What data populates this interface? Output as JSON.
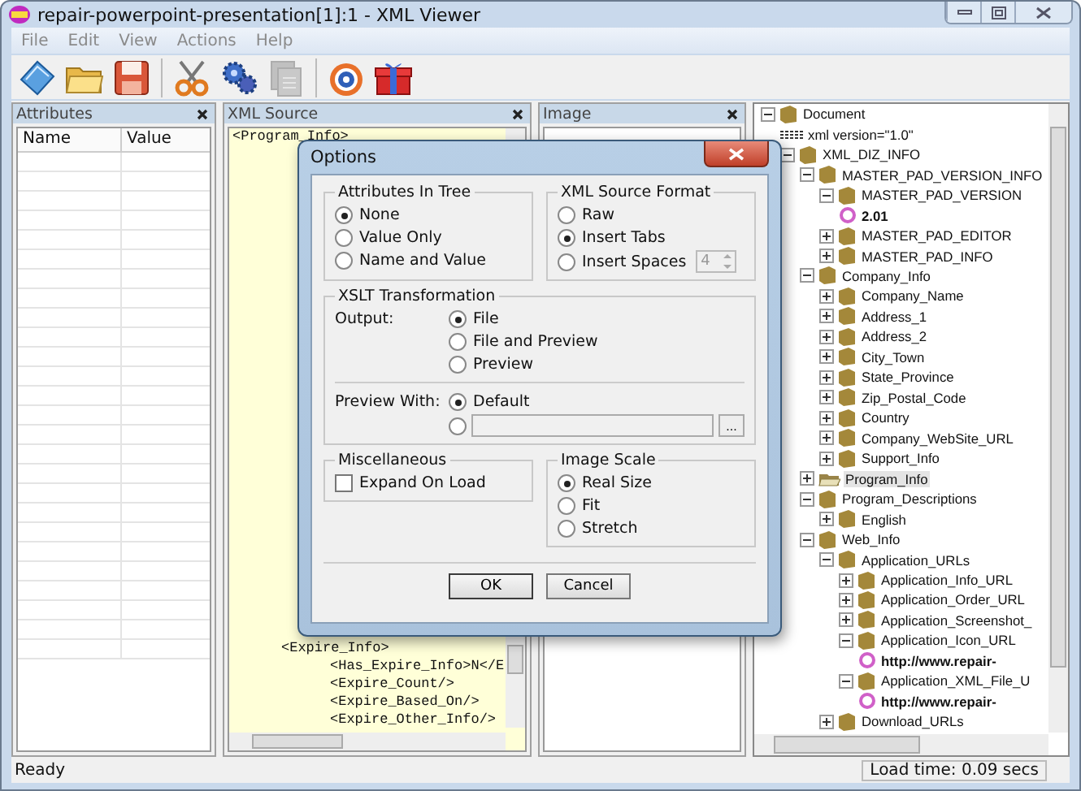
{
  "window": {
    "title": "repair-powerpoint-presentation[1]:1 - XML Viewer"
  },
  "menu": [
    "File",
    "Edit",
    "View",
    "Actions",
    "Help"
  ],
  "toolbar": [
    [
      {
        "kind": "notebook",
        "disabled": false
      },
      {
        "kind": "folder",
        "disabled": false
      },
      {
        "kind": "disk",
        "disabled": false
      }
    ],
    [
      {
        "kind": "scissors",
        "disabled": false
      },
      {
        "kind": "gears",
        "disabled": false
      },
      {
        "kind": "pages",
        "disabled": true
      }
    ],
    [
      {
        "kind": "target",
        "disabled": false
      },
      {
        "kind": "gift",
        "disabled": false
      }
    ]
  ],
  "attributes": {
    "title": "Attributes",
    "columns": [
      "Name",
      "Value"
    ]
  },
  "xml_source": {
    "title": "XML Source",
    "top_lines": [
      "<Program_Info>"
    ],
    "bottom_block": {
      "text": "<Expire_Info>",
      "children": [
        "<Has_Expire_Info>N</E",
        "<Expire_Count/>",
        "<Expire_Based_On/>",
        "<Expire_Other_Info/>"
      ]
    }
  },
  "image": {
    "title": "Image"
  },
  "tree": [
    {
      "kind": "element",
      "label": "Document",
      "expanded": true,
      "selected": false,
      "children": [
        {
          "kind": "declaration",
          "label": "xml version=\"1.0\"",
          "selected": false
        },
        {
          "kind": "element",
          "label": "XML_DIZ_INFO",
          "expanded": true,
          "selected": false,
          "children": [
            {
              "kind": "element",
              "label": "MASTER_PAD_VERSION_INFO",
              "expanded": true,
              "selected": false,
              "children": [
                {
                  "kind": "element",
                  "label": "MASTER_PAD_VERSION",
                  "expanded": true,
                  "selected": false,
                  "children": [
                    {
                      "kind": "value",
                      "label": "2.01",
                      "selected": false
                    }
                  ]
                },
                {
                  "kind": "element",
                  "label": "MASTER_PAD_EDITOR",
                  "expanded": false,
                  "selected": false
                },
                {
                  "kind": "element",
                  "label": "MASTER_PAD_INFO",
                  "expanded": false,
                  "selected": false
                }
              ]
            },
            {
              "kind": "element",
              "label": "Company_Info",
              "expanded": true,
              "selected": false,
              "children": [
                {
                  "kind": "element",
                  "label": "Company_Name",
                  "expanded": false,
                  "selected": false
                },
                {
                  "kind": "element",
                  "label": "Address_1",
                  "expanded": false,
                  "selected": false
                },
                {
                  "kind": "element",
                  "label": "Address_2",
                  "expanded": false,
                  "selected": false
                },
                {
                  "kind": "element",
                  "label": "City_Town",
                  "expanded": false,
                  "selected": false
                },
                {
                  "kind": "element",
                  "label": "State_Province",
                  "expanded": false,
                  "selected": false
                },
                {
                  "kind": "element",
                  "label": "Zip_Postal_Code",
                  "expanded": false,
                  "selected": false
                },
                {
                  "kind": "element",
                  "label": "Country",
                  "expanded": false,
                  "selected": false
                },
                {
                  "kind": "element",
                  "label": "Company_WebSite_URL",
                  "expanded": false,
                  "selected": false
                },
                {
                  "kind": "element",
                  "label": "Support_Info",
                  "expanded": false,
                  "selected": false
                }
              ]
            },
            {
              "kind": "element",
              "label": "Program_Info",
              "expanded": false,
              "selected": true
            },
            {
              "kind": "element",
              "label": "Program_Descriptions",
              "expanded": true,
              "selected": false,
              "children": [
                {
                  "kind": "element",
                  "label": "English",
                  "expanded": false,
                  "selected": false
                }
              ]
            },
            {
              "kind": "element",
              "label": "Web_Info",
              "expanded": true,
              "selected": false,
              "children": [
                {
                  "kind": "element",
                  "label": "Application_URLs",
                  "expanded": true,
                  "selected": false,
                  "children": [
                    {
                      "kind": "element",
                      "label": "Application_Info_URL",
                      "expanded": false,
                      "selected": false
                    },
                    {
                      "kind": "element",
                      "label": "Application_Order_URL",
                      "expanded": false,
                      "selected": false
                    },
                    {
                      "kind": "element",
                      "label": "Application_Screenshot_",
                      "expanded": false,
                      "selected": false
                    },
                    {
                      "kind": "element",
                      "label": "Application_Icon_URL",
                      "expanded": true,
                      "selected": false,
                      "children": [
                        {
                          "kind": "value",
                          "label": "http://www.repair-",
                          "selected": false
                        }
                      ]
                    },
                    {
                      "kind": "element",
                      "label": "Application_XML_File_U",
                      "expanded": true,
                      "selected": false,
                      "children": [
                        {
                          "kind": "value",
                          "label": "http://www.repair-",
                          "selected": false
                        }
                      ]
                    }
                  ]
                },
                {
                  "kind": "element",
                  "label": "Download_URLs",
                  "expanded": false,
                  "selected": false
                }
              ]
            }
          ]
        }
      ]
    }
  ],
  "dialog": {
    "title": "Options",
    "attributes_in_tree": {
      "title": "Attributes In Tree",
      "options": [
        {
          "label": "None",
          "selected": true
        },
        {
          "label": "Value Only",
          "selected": false
        },
        {
          "label": "Name and Value",
          "selected": false
        }
      ]
    },
    "xml_source_format": {
      "title": "XML Source Format",
      "options": [
        {
          "label": "Raw",
          "selected": false
        },
        {
          "label": "Insert Tabs",
          "selected": true
        },
        {
          "label": "Insert Spaces",
          "selected": false
        }
      ],
      "spaces_value": "4",
      "spaces_disabled": true
    },
    "xslt": {
      "title": "XSLT Transformation",
      "output_label": "Output:",
      "output_options": [
        {
          "label": "File",
          "selected": true
        },
        {
          "label": "File and Preview",
          "selected": false
        },
        {
          "label": "Preview",
          "selected": false
        }
      ],
      "preview_label": "Preview With:",
      "preview_options": [
        {
          "label": "Default",
          "selected": true
        },
        {
          "kind": "path",
          "selected": false
        }
      ],
      "browse_button": "..."
    },
    "miscellaneous": {
      "title": "Miscellaneous",
      "checkbox": {
        "label": "Expand On Load",
        "checked": false
      }
    },
    "image_scale": {
      "title": "Image Scale",
      "options": [
        {
          "label": "Real Size",
          "selected": true
        },
        {
          "label": "Fit",
          "selected": false
        },
        {
          "label": "Stretch",
          "selected": false
        }
      ]
    },
    "buttons": [
      "OK",
      "Cancel"
    ]
  },
  "status_bar": {
    "message": "Ready",
    "load_time": "Load time: 0.09 secs"
  }
}
